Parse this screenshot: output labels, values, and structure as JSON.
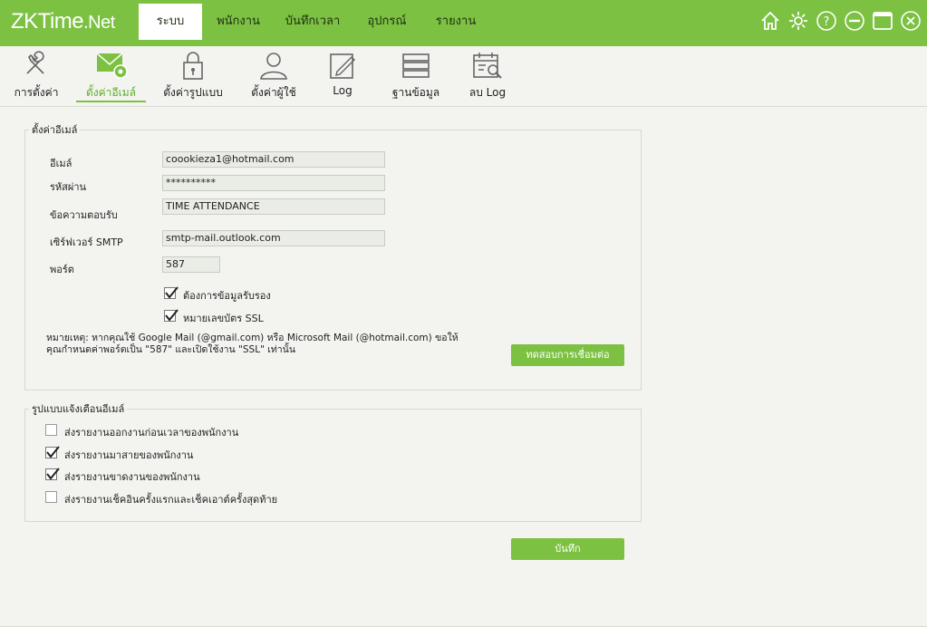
{
  "app": {
    "logo_main": "ZKTime",
    "logo_suffix": ".Net"
  },
  "menu": [
    {
      "label": "ระบบ"
    },
    {
      "label": "พนักงาน"
    },
    {
      "label": "บันทึกเวลา"
    },
    {
      "label": "อุปกรณ์"
    },
    {
      "label": "รายงาน"
    }
  ],
  "window_icons": [
    "home-icon",
    "gear-icon",
    "help-icon",
    "minimize-icon",
    "maximize-icon",
    "close-icon"
  ],
  "toolbar": [
    {
      "label": "การตั้งค่า",
      "icon": "tools-icon"
    },
    {
      "label": "ตั้งค่าอีเมล์",
      "icon": "email-settings-icon"
    },
    {
      "label": "ตั้งค่ารูปแบบ",
      "icon": "lock-icon"
    },
    {
      "label": "ตั้งค่าผู้ใช้",
      "icon": "user-icon"
    },
    {
      "label": "Log",
      "icon": "log-icon"
    },
    {
      "label": "ฐานข้อมูล",
      "icon": "database-icon"
    },
    {
      "label": "ลบ Log",
      "icon": "delete-log-icon"
    }
  ],
  "email_settings": {
    "legend": "ตั้งค่าอีเมล์",
    "email_label": "อีเมล์",
    "email_value": "coookieza1@hotmail.com",
    "password_label": "รหัสผ่าน",
    "password_value": "**********",
    "reply_label": "ข้อความตอบรับ",
    "reply_value": "TIME ATTENDANCE",
    "smtp_label": "เซิร์ฟเวอร์ SMTP",
    "smtp_value": "smtp-mail.outlook.com",
    "port_label": "พอร์ต",
    "port_value": "587",
    "auth_label": "ต้องการข้อมูลรับรอง",
    "ssl_label": "หมายเลขบัตร SSL",
    "note_line1": "หมายเหตุ: หากคุณใช้ Google Mail (@gmail.com) หรือ Microsoft Mail (@hotmail.com) ขอให้",
    "note_line2": "คุณกำหนดค่าพอร์ตเป็น \"587\" และเปิดใช้งาน \"SSL\" เท่านั้น",
    "test_button": "ทดสอบการเชื่อมต่อ"
  },
  "notify": {
    "legend": "รูปแบบแจ้งเตือนอีเมล์",
    "items": [
      {
        "label": "ส่งรายงานออกงานก่อนเวลาของพนักงาน",
        "checked": false
      },
      {
        "label": "ส่งรายงานมาสายของพนักงาน",
        "checked": true
      },
      {
        "label": "ส่งรายงานขาดงานของพนักงาน",
        "checked": true
      },
      {
        "label": "ส่งรายงานเช็คอินครั้งแรกและเช็คเอาต์ครั้งสุดท้าย",
        "checked": false
      }
    ]
  },
  "save_button": "บันทึก",
  "colors": {
    "accent": "#7cc142",
    "background": "#f3f4f0"
  }
}
